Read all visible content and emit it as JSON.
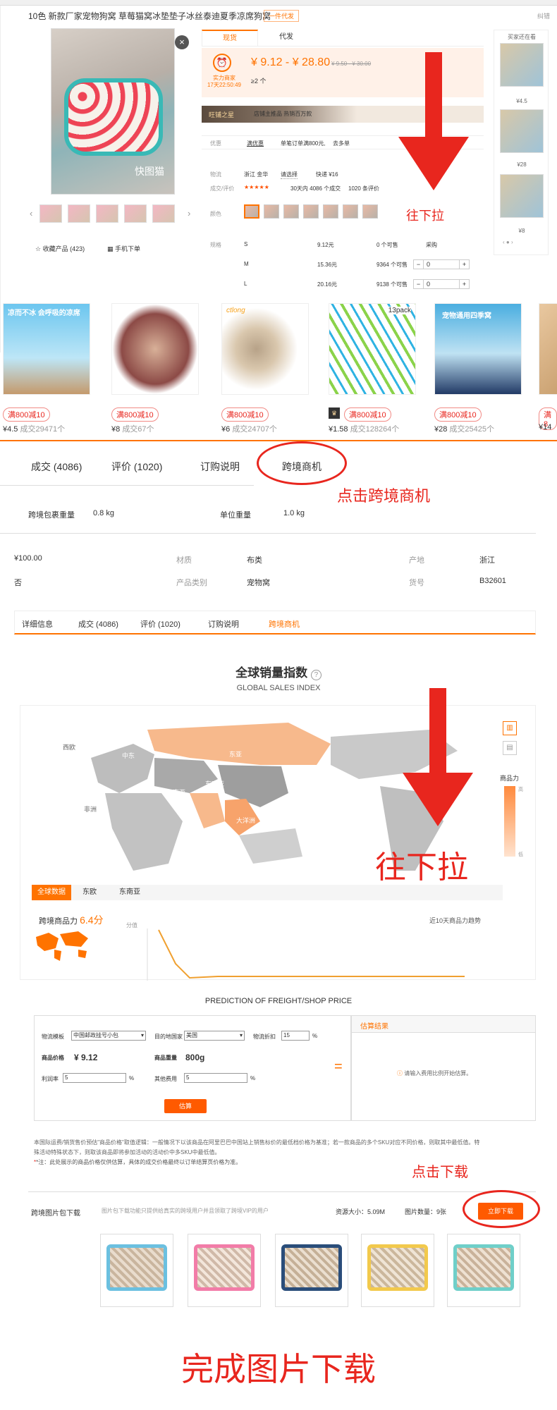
{
  "header": {
    "product_title": "10色 新款厂家宠物狗窝 草莓猫窝冰垫垫子冰丝泰迪夏季凉席狗窝",
    "tag": "一件代发",
    "edit_link": "纠错"
  },
  "gallery": {
    "watermark": "快图猫",
    "close": "×",
    "prev": "‹",
    "next": "›",
    "favorite": "收藏产品 (423)",
    "mobile_order": "手机下单"
  },
  "price_tabs": [
    "现货",
    "代发"
  ],
  "price": {
    "countdown_label": "实力商家",
    "countdown_time": "17天22:50:49",
    "range": "¥ 9.12 - ¥ 28.80",
    "old_range": "¥ 9.50 - ¥ 30.00",
    "min_order": "≥2 个"
  },
  "shop_bar": {
    "label": "旺铺之星",
    "text": "店铺主推品  热销百万款"
  },
  "promo": {
    "label": "优惠",
    "value": "满优惠",
    "detail": "单笔订单满800元,",
    "more": "去多单"
  },
  "logistics": {
    "label": "物流",
    "from": "浙江 金华",
    "to": "请选择",
    "express": "快递 ¥16"
  },
  "review": {
    "label": "成交/评价",
    "stars": "★★★★★",
    "sales": "30天内 4086 个成交",
    "reviews": "1020 条评价"
  },
  "color_label": "颜色",
  "sku": {
    "label": "规格",
    "rows": [
      {
        "size": "S",
        "price": "9.12元",
        "stock": "0 个可售",
        "qty": ""
      },
      {
        "size": "M",
        "price": "15.36元",
        "stock": "9364 个可售",
        "qty": "0"
      },
      {
        "size": "L",
        "price": "20.16元",
        "stock": "9138 个可售",
        "qty": "0"
      }
    ],
    "qty_header": "采购"
  },
  "right_col": {
    "header": "买家还在看",
    "prices": [
      "¥4.5",
      "¥28",
      "¥8"
    ],
    "pager": "‹  ●  ›"
  },
  "annotations": {
    "pull_down_1": "往下拉",
    "click_cross_border": "点击跨境商机",
    "pull_down_2": "往下拉",
    "click_download": "点击下载",
    "finish": "完成图片下载"
  },
  "strip": {
    "items": [
      {
        "badge": "满800减10",
        "price": "¥4.5",
        "sales": "成交29471个",
        "label": "凉而不冰 会呼吸的凉席"
      },
      {
        "badge": "满800减10",
        "price": "¥8",
        "sales": "成交67个",
        "label": ""
      },
      {
        "badge": "满800减10",
        "price": "¥6",
        "sales": "成交24707个",
        "label": "ctlong"
      },
      {
        "badge": "满800减10",
        "price": "¥1.58",
        "sales": "成交128264个",
        "label": "13pack"
      },
      {
        "badge": "满800减10",
        "price": "¥28",
        "sales": "成交25425个",
        "label": "宠物通用四季窝"
      },
      {
        "badge": "满8",
        "price": "¥14",
        "sales": "",
        "label": ""
      }
    ]
  },
  "tabs_main": [
    "成交 (4086)",
    "评价 (1020)",
    "订购说明",
    "跨境商机"
  ],
  "weights": {
    "pack_label": "跨境包裹重量",
    "pack_value": "0.8 kg",
    "unit_label": "单位重量",
    "unit_value": "1.0 kg"
  },
  "attrs": {
    "price": "¥100.00",
    "material_label": "材质",
    "material": "布类",
    "origin_label": "产地",
    "origin": "浙江",
    "no": "否",
    "category_label": "产品类别",
    "category": "宠物窝",
    "item_no_label": "货号",
    "item_no": "B32601"
  },
  "tabs_detail": [
    "详细信息",
    "成交 (4086)",
    "评价 (1020)",
    "订购说明",
    "跨境商机"
  ],
  "gsi": {
    "title": "全球销量指数",
    "help": "?",
    "subtitle": "GLOBAL SALES INDEX",
    "regions": [
      "西欧",
      "东欧",
      "中东",
      "东亚",
      "南亚",
      "东南亚",
      "非洲",
      "大洋洲",
      "南美"
    ],
    "legend_title": "商品力",
    "legend_high": "高",
    "legend_low": "低",
    "tabs": [
      "全球数据",
      "东欧",
      "东南亚"
    ],
    "score_label": "跨境商品力",
    "score": "6.4分",
    "trend_label": "近10天商品力趋势",
    "y_label": "分值"
  },
  "freight": {
    "title": "PREDICTION OF FREIGHT/SHOP PRICE",
    "template_label": "物流模板",
    "template_value": "中国邮政挂号小包",
    "dest_label": "目的地国家",
    "dest_value": "美国",
    "discount_label": "物流折扣",
    "discount_value": "15",
    "pct": "%",
    "price_label": "商品价格",
    "price_value": "¥ 9.12",
    "weight_label": "商品重量",
    "weight_value": "800g",
    "profit_label": "利润率",
    "profit_value": "5",
    "other_label": "其他费用",
    "other_value": "5",
    "calc_button": "估算",
    "equals": "=",
    "result_header": "估算结果",
    "result_hint": "请输入费用比例开始估算。"
  },
  "notes": {
    "line1": "本国际运费/销货售价预估\"商品价格\"取值逻辑：一般情况下以该商品在阿里巴巴中国站上销售标价的最低档价格为基准；若一款商品的多个SKU对应不同价格，则取其中最低值。特",
    "line2": "殊活动特殊状态下，则取该商品即将参加活动的活动价中多SKU中最低值。",
    "line3": "*注：此处展示的商品价格仅供估算，具体的成交价格最终以订单结算页价格为准。"
  },
  "download": {
    "label": "跨境图片包下载",
    "desc": "图片包下载功能只提供给真实的跨境用户并且领取了跨境VIP的用户",
    "size": "资源大小：5.09M",
    "count": "图片数量：9张",
    "button": "立即下载"
  }
}
